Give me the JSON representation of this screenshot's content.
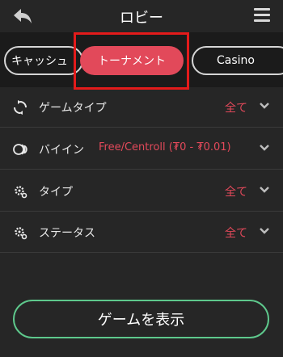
{
  "header": {
    "title": "ロビー",
    "back_icon": "back-arrow-icon",
    "menu_icon": "hamburger-menu-icon"
  },
  "tabs": [
    {
      "label": "キャッシュ"
    },
    {
      "label": "トーナメント",
      "selected": true
    },
    {
      "label": "Casino"
    }
  ],
  "filters": [
    {
      "label": "ゲームタイプ",
      "value": "全て",
      "icon": "refresh-cycle-icon"
    },
    {
      "label": "バイイン",
      "value": "Free/Centroll (₮0 - ₮0.01)",
      "icon": "coins-icon"
    },
    {
      "label": "タイプ",
      "value": "全て",
      "icon": "gear-icon"
    },
    {
      "label": "ステータス",
      "value": "全て",
      "icon": "gear-icon"
    }
  ],
  "show_button": {
    "label": "ゲームを表示"
  },
  "colors": {
    "accent": "#e2495a",
    "background": "#262626",
    "tabbar_background": "#1b1b1b",
    "highlight_box": "#e31b1b",
    "button_border": "#5ec88c"
  }
}
